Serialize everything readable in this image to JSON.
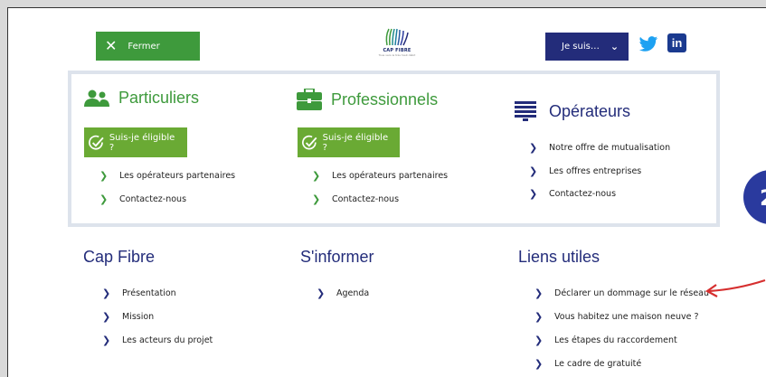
{
  "header": {
    "close_label": "Fermer",
    "logo_text": "CAP FIBRE",
    "logo_tagline": "Tous vers le très haut débit",
    "jesuis_label": "Je suis…"
  },
  "columns": {
    "particuliers": {
      "title": "Particuliers",
      "eligibility_label": "Suis-je éligible ?",
      "links": [
        "Les opérateurs partenaires",
        "Contactez-nous"
      ]
    },
    "professionnels": {
      "title": "Professionnels",
      "eligibility_label": "Suis-je éligible ?",
      "links": [
        "Les opérateurs partenaires",
        "Contactez-nous"
      ]
    },
    "operateurs": {
      "title": "Opérateurs",
      "links": [
        "Notre offre de mutualisation",
        "Les offres entreprises",
        "Contactez-nous"
      ]
    }
  },
  "footer": {
    "cap_fibre": {
      "title": "Cap Fibre",
      "links": [
        "Présentation",
        "Mission",
        "Les acteurs du projet"
      ]
    },
    "sinformer": {
      "title": "S'informer",
      "links": [
        "Agenda"
      ]
    },
    "liens_utiles": {
      "title": "Liens utiles",
      "links": [
        "Déclarer un dommage sur le réseau",
        "Vous habitez une maison neuve ?",
        "Les étapes du raccordement",
        "Le cadre de gratuité"
      ]
    }
  },
  "annotation": {
    "circle_digit": "2",
    "arrow_color": "#d62f2f"
  },
  "colors": {
    "green": "#3e9a3c",
    "light_green": "#6aaa34",
    "navy": "#232c7a",
    "box_border": "#dde3ec"
  },
  "icons": [
    "close-icon",
    "logo-icon",
    "chevron-down-icon",
    "twitter-icon",
    "linkedin-icon",
    "users-icon",
    "briefcase-icon",
    "server-icon",
    "check-circle-icon",
    "chevron-right-icon"
  ]
}
